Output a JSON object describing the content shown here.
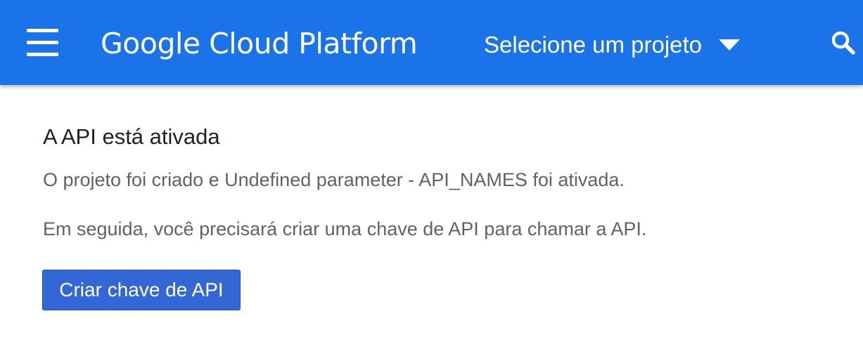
{
  "header": {
    "brand": "Google Cloud Platform",
    "project_selector_label": "Selecione um projeto",
    "icons": {
      "menu": "hamburger-menu-icon",
      "dropdown": "caret-down-icon",
      "search": "search-icon"
    }
  },
  "main": {
    "title": "A API está ativada",
    "message_1": "O projeto foi criado e Undefined parameter - API_NAMES foi ativada.",
    "message_2": "Em seguida, você precisará criar uma chave de API para chamar a API.",
    "create_key_button": "Criar chave de API"
  },
  "colors": {
    "header_bg": "#1a73e8",
    "primary_button": "#3367d6",
    "heading_text": "#202124",
    "body_text": "#5f6368"
  }
}
